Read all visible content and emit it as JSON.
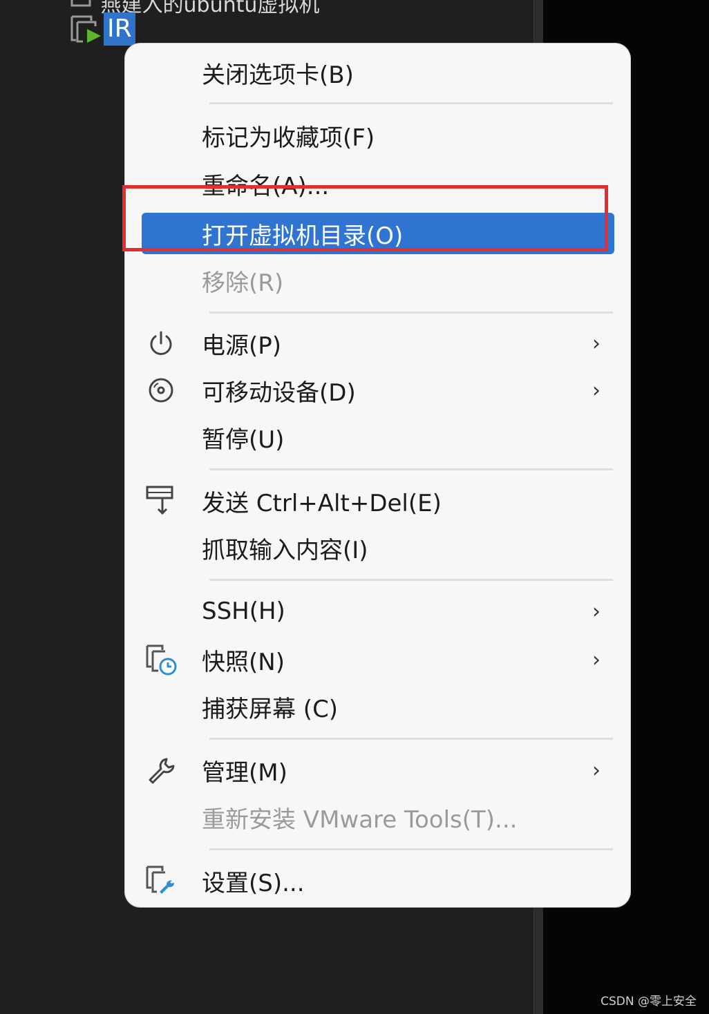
{
  "tree": {
    "prev_item_label": "燕建入的ubuntu虚拟机",
    "selected_item_label": "IR"
  },
  "menu": {
    "items": [
      {
        "label": "关闭选项卡(B)"
      },
      {
        "label": "标记为收藏项(F)"
      },
      {
        "label": "重命名(A)..."
      },
      {
        "label": "打开虚拟机目录(O)"
      },
      {
        "label": "移除(R)"
      },
      {
        "label": "电源(P)",
        "icon": "power-icon"
      },
      {
        "label": "可移动设备(D)",
        "icon": "disc-icon"
      },
      {
        "label": "暂停(U)"
      },
      {
        "label": "发送 Ctrl+Alt+Del(E)",
        "icon": "send-keys-icon"
      },
      {
        "label": "抓取输入内容(I)"
      },
      {
        "label": "SSH(H)"
      },
      {
        "label": "快照(N)",
        "icon": "snapshot-icon"
      },
      {
        "label": "捕获屏幕 (C)"
      },
      {
        "label": "管理(M)",
        "icon": "wrench-icon"
      },
      {
        "label": "重新安装 VMware Tools(T)..."
      },
      {
        "label": "设置(S)...",
        "icon": "settings-vm-icon"
      }
    ],
    "submenu_arrow": "›",
    "highlight_color": "#2f74d0",
    "annotation_color": "#e03131"
  },
  "watermark": "CSDN @零上安全"
}
